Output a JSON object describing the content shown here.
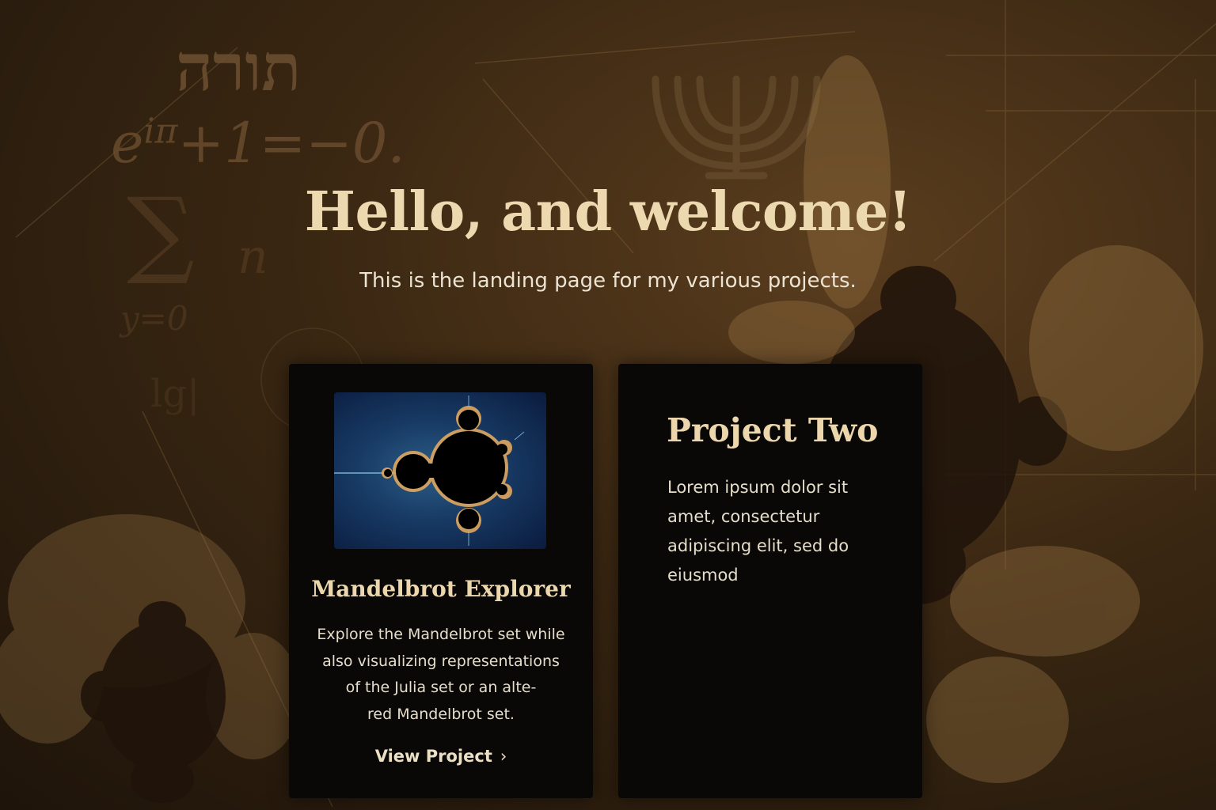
{
  "hero": {
    "title": "Hello, and welcome!",
    "subtitle": "This is the landing page for my various projects."
  },
  "background": {
    "hebrew": "תורה",
    "euler_base": "e",
    "euler_exponent": "iπ",
    "euler_rest": "+1=−0.",
    "sum_symbol": "∑",
    "n_symbol": "n",
    "y_equals": "y=0",
    "lg_symbol": "lg|"
  },
  "cards": [
    {
      "title": "Mandelbrot Explorer",
      "description_lines": [
        "Explore the Mandelbrot set while",
        "also visualizing representations",
        "of the Julia set or an alte-",
        "red Mandelbrot set."
      ],
      "link_label": "View Project",
      "link_icon": "chevron-right-icon"
    },
    {
      "title": "Project Two",
      "description_lines": [
        "Lorem ipsum dolor sit",
        "amet, consectetur",
        "adipiscing elit, sed  do",
        "eiusmod"
      ]
    }
  ],
  "colors": {
    "title_gold": "#ecd9b0",
    "card_bg": "#090806",
    "page_bg": "#3a2712"
  }
}
